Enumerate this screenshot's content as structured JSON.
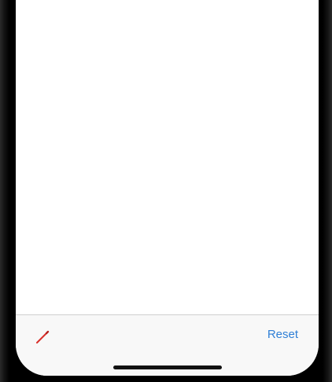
{
  "toolbar": {
    "reset_label": "Reset",
    "pencil_icon": "pencil-icon",
    "pencil_color": "#d9302b"
  },
  "colors": {
    "accent": "#2f7fd6",
    "background": "#ffffff",
    "toolbar_bg": "#f8f8f8",
    "bezel": "#000000"
  }
}
